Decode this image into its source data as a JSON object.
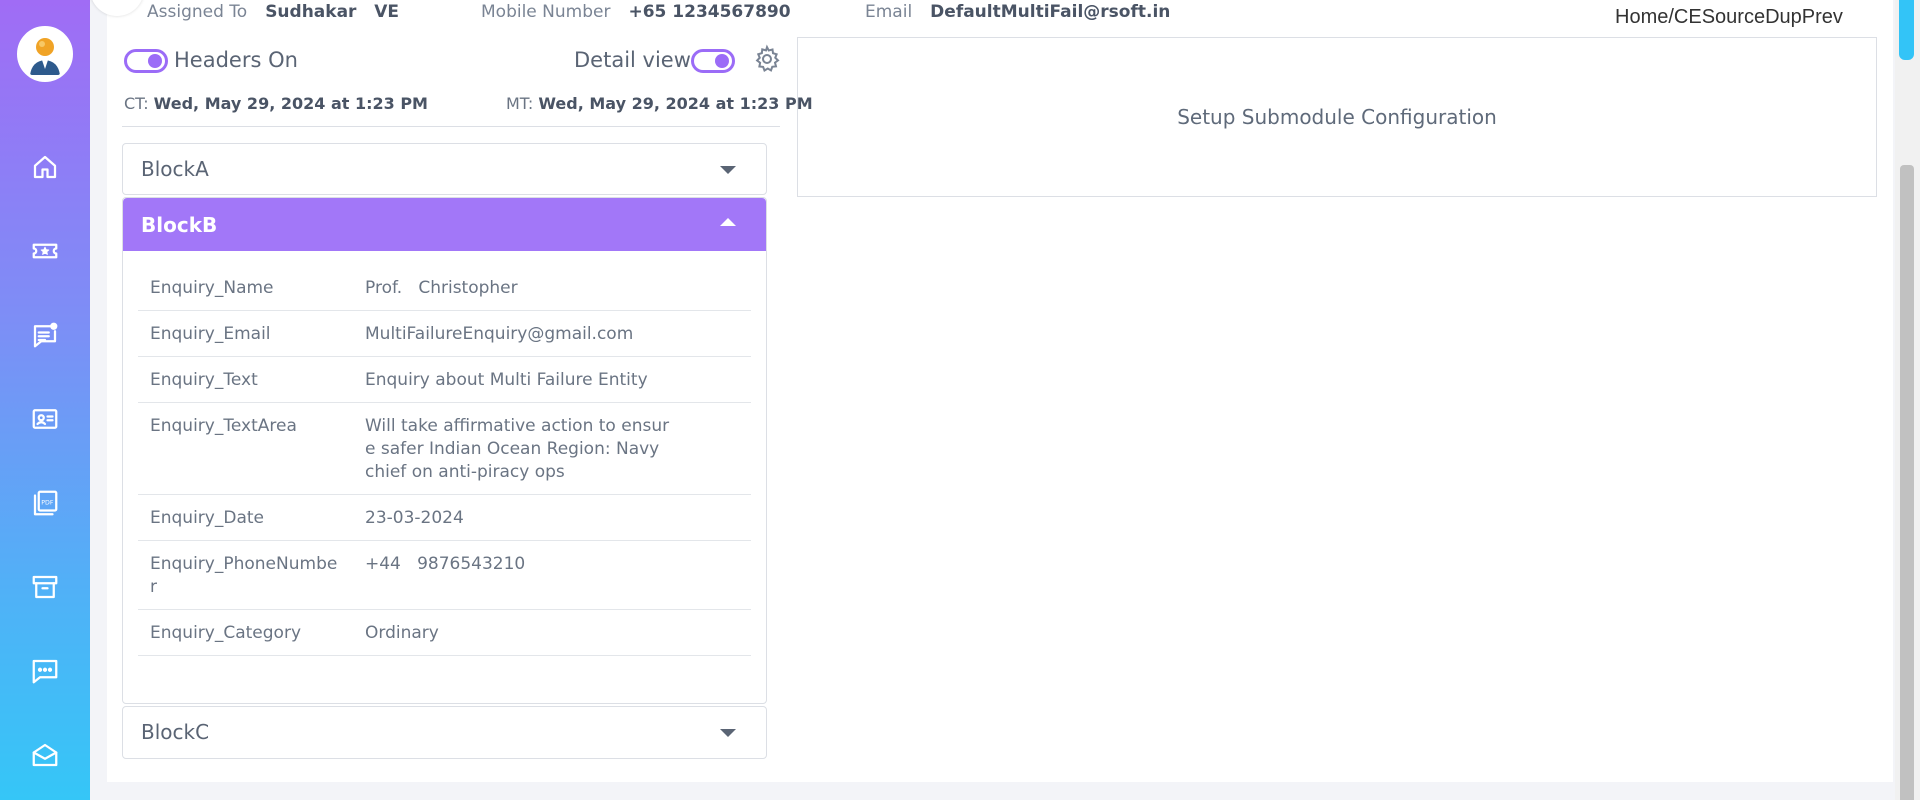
{
  "header": {
    "assigned_to_label": "Assigned To",
    "assigned_to_value": "Sudhakar   VE",
    "mobile_label": "Mobile Number",
    "mobile_value": "+65 1234567890",
    "email_label": "Email",
    "email_value": "DefaultMultiFail@rsoft.in"
  },
  "breadcrumb": {
    "home": "Home",
    "sep": "/",
    "current": "CESourceDupPrev"
  },
  "toggles": {
    "headers_label": "Headers On",
    "headers_on": true,
    "detail_label": "Detail view",
    "detail_on": true
  },
  "timestamps": {
    "ct_label": "CT:",
    "ct_value": "Wed, May 29, 2024 at 1:23 PM",
    "mt_label": "MT:",
    "mt_value": "Wed, May 29, 2024 at 1:23 PM"
  },
  "blocks": {
    "a": {
      "title": "BlockA",
      "expanded": false
    },
    "b": {
      "title": "BlockB",
      "expanded": true,
      "rows": [
        {
          "key": "Enquiry_Name",
          "value": "Prof.   Christopher"
        },
        {
          "key": "Enquiry_Email",
          "value": "MultiFailureEnquiry@gmail.com"
        },
        {
          "key": "Enquiry_Text",
          "value": "Enquiry about Multi Failure Entity"
        },
        {
          "key": "Enquiry_TextArea",
          "value": "Will take affirmative action to ensure safer Indian Ocean Region: Navy chief on anti-piracy ops"
        },
        {
          "key": "Enquiry_Date",
          "value": "23-03-2024"
        },
        {
          "key": "Enquiry_PhoneNumber",
          "value": "+44   9876543210"
        },
        {
          "key": "Enquiry_Category",
          "value": "Ordinary"
        }
      ]
    },
    "c": {
      "title": "BlockC",
      "expanded": false
    }
  },
  "setup_panel": {
    "text": "Setup Submodule Configuration"
  },
  "sidebar": {
    "items": [
      {
        "icon": "home-icon"
      },
      {
        "icon": "ticket-icon"
      },
      {
        "icon": "notes-icon"
      },
      {
        "icon": "contact-card-icon"
      },
      {
        "icon": "pdf-icon"
      },
      {
        "icon": "archive-icon"
      },
      {
        "icon": "chat-icon"
      },
      {
        "icon": "mail-icon"
      }
    ]
  },
  "colors": {
    "accent": "#a277f8",
    "sidebar_top": "#a06cf5",
    "sidebar_bottom": "#35c6f7"
  }
}
